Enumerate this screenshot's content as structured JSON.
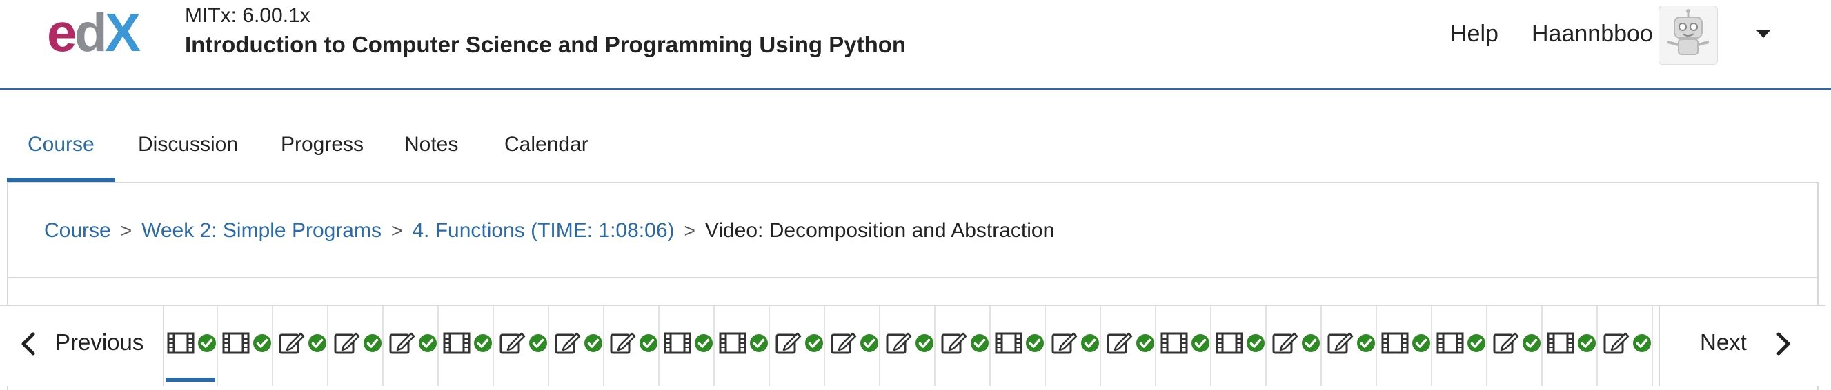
{
  "header": {
    "logo_text": "edX",
    "course_org": "MITx: 6.00.1x",
    "course_title": "Introduction to Computer Science and Programming Using Python",
    "help_label": "Help",
    "username": "Haannbboo",
    "avatar_icon": "robot-avatar-icon",
    "menu_icon": "caret-down-icon"
  },
  "tabs": [
    {
      "label": "Course",
      "active": true
    },
    {
      "label": "Discussion",
      "active": false
    },
    {
      "label": "Progress",
      "active": false
    },
    {
      "label": "Notes",
      "active": false
    },
    {
      "label": "Calendar",
      "active": false
    }
  ],
  "breadcrumb": {
    "items": [
      "Course",
      "Week 2: Simple Programs",
      "4. Functions (TIME: 1:08:06)"
    ],
    "current": "Video: Decomposition and Abstraction",
    "separator": ">"
  },
  "sequence": {
    "previous_label": "Previous",
    "next_label": "Next",
    "items": [
      {
        "type": "video",
        "completed": true,
        "active": true
      },
      {
        "type": "video",
        "completed": true,
        "active": false
      },
      {
        "type": "problem",
        "completed": true,
        "active": false
      },
      {
        "type": "problem",
        "completed": true,
        "active": false
      },
      {
        "type": "problem",
        "completed": true,
        "active": false
      },
      {
        "type": "video",
        "completed": true,
        "active": false
      },
      {
        "type": "problem",
        "completed": true,
        "active": false
      },
      {
        "type": "problem",
        "completed": true,
        "active": false
      },
      {
        "type": "problem",
        "completed": true,
        "active": false
      },
      {
        "type": "video",
        "completed": true,
        "active": false
      },
      {
        "type": "video",
        "completed": true,
        "active": false
      },
      {
        "type": "problem",
        "completed": true,
        "active": false
      },
      {
        "type": "problem",
        "completed": true,
        "active": false
      },
      {
        "type": "problem",
        "completed": true,
        "active": false
      },
      {
        "type": "problem",
        "completed": true,
        "active": false
      },
      {
        "type": "video",
        "completed": true,
        "active": false
      },
      {
        "type": "problem",
        "completed": true,
        "active": false
      },
      {
        "type": "problem",
        "completed": true,
        "active": false
      },
      {
        "type": "video",
        "completed": true,
        "active": false
      },
      {
        "type": "video",
        "completed": true,
        "active": false
      },
      {
        "type": "problem",
        "completed": true,
        "active": false
      },
      {
        "type": "problem",
        "completed": true,
        "active": false
      },
      {
        "type": "video",
        "completed": true,
        "active": false
      },
      {
        "type": "video",
        "completed": true,
        "active": false
      },
      {
        "type": "problem",
        "completed": true,
        "active": false
      },
      {
        "type": "video",
        "completed": true,
        "active": false
      },
      {
        "type": "problem",
        "completed": true,
        "active": false
      }
    ]
  },
  "colors": {
    "accent": "#2b6aa8",
    "check": "#2e8b24",
    "logo_e": "#b12a63",
    "logo_x": "#3b97d6"
  }
}
